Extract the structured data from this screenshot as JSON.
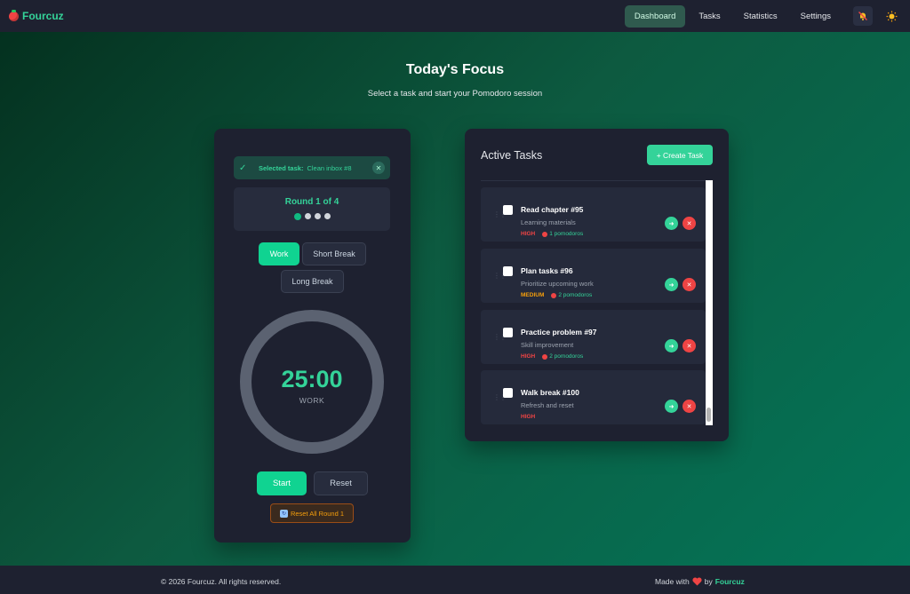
{
  "nav": {
    "brand": "Fourcuz",
    "links": [
      "Dashboard",
      "Tasks",
      "Statistics",
      "Settings"
    ],
    "active_link": "Dashboard",
    "icons": [
      "bell-off-icon",
      "sun-icon"
    ]
  },
  "page": {
    "title": "Today's Focus",
    "subtitle": "Select a task and start your Pomodoro session"
  },
  "timer": {
    "selected_label": "Selected task:",
    "selected_value": "Clean inbox #8",
    "round_text": "Round 1 of 4",
    "round_current": 1,
    "round_total": 4,
    "modes": [
      "Work",
      "Short Break",
      "Long Break"
    ],
    "active_mode": "Work",
    "time": "25:00",
    "mode_label": "WORK",
    "start_label": "Start",
    "reset_label": "Reset",
    "reset_all_label": "Reset All Round 1"
  },
  "tasks": {
    "title": "Active Tasks",
    "create_label": "+ Create Task",
    "items": [
      {
        "title": "Read chapter #95",
        "desc": "Learning materials",
        "priority": "HIGH",
        "pomodoros": "1 pomodoros"
      },
      {
        "title": "Plan tasks #96",
        "desc": "Prioritize upcoming work",
        "priority": "MEDIUM",
        "pomodoros": "2 pomodoros"
      },
      {
        "title": "Practice problem #97",
        "desc": "Skill improvement",
        "priority": "HIGH",
        "pomodoros": "2 pomodoros"
      },
      {
        "title": "Walk break #100",
        "desc": "Refresh and reset",
        "priority": "HIGH",
        "pomodoros": ""
      }
    ]
  },
  "footer": {
    "copyright": "© 2026 Fourcuz. All rights reserved.",
    "made_with": "Made with",
    "by": "by",
    "brand": "Fourcuz"
  },
  "colors": {
    "accent": "#34d399",
    "accent_strong": "#10d391",
    "danger": "#ef4444",
    "warning": "#f59e0b",
    "card": "#1e2130"
  }
}
